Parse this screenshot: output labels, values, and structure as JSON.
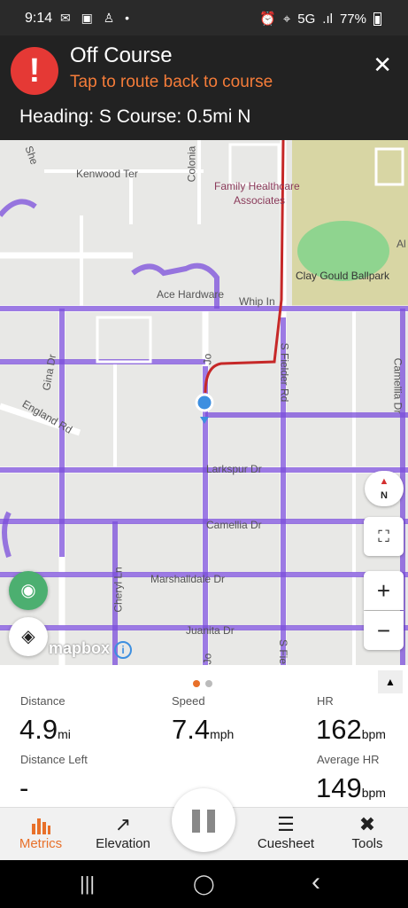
{
  "status_bar": {
    "time": "9:14",
    "left_icons": "✉ ▣ ♙ •",
    "alarm_icon": "⏰",
    "location_icon": "⌖",
    "network": "5G",
    "signal_icon": ".ıl",
    "battery": "77%"
  },
  "banner": {
    "title": "Off Course",
    "subtitle": "Tap to route back to course",
    "heading": "Heading: S Course: 0.5mi N",
    "alert_glyph": "!",
    "close_glyph": "✕",
    "alert_color": "#e53935",
    "subtitle_color": "#f57c39"
  },
  "map": {
    "labels": {
      "kenwood": "Kenwood Ter",
      "colonia": "Colonia",
      "sheri": "She",
      "family": "Family Healthcare",
      "associates": "Associates",
      "clay": "Clay Gould Ballpark",
      "al": "Al",
      "ace": "Ace Hardware",
      "whip": "Whip In",
      "fielder": "S Fielder Rd",
      "fielder2": "S Fie",
      "gina": "Gina Dr",
      "england": "England Rd",
      "camellia_right": "Camellia Dr",
      "larkspur": "Larkspur Dr",
      "camellia": "Camellia Dr",
      "cheryl": "Cheryl Ln",
      "marshalldale": "Marshalldale Dr",
      "juanita": "Juanita Dr",
      "jo": "Jo",
      "jo2": "Jo"
    },
    "attribution": "mapbox",
    "info_glyph": "i",
    "compass_letter": "N",
    "zoom_in": "+",
    "zoom_out": "−",
    "fullscreen_glyph": "⛶",
    "heatmap_color": "#7b4ddb",
    "route_color": "#c62828"
  },
  "metrics": {
    "distance_label": "Distance",
    "distance_value": "4.9",
    "distance_unit": "mi",
    "speed_label": "Speed",
    "speed_value": "7.4",
    "speed_unit": "mph",
    "hr_label": "HR",
    "hr_value": "162",
    "hr_unit": "bpm",
    "distance_left_label": "Distance Left",
    "distance_left_value": "-",
    "avg_hr_label": "Average HR",
    "avg_hr_value": "149",
    "avg_hr_unit": "bpm",
    "collapse_glyph": "▲"
  },
  "nav": {
    "metrics": "Metrics",
    "elevation": "Elevation",
    "cuesheet": "Cuesheet",
    "tools": "Tools",
    "elevation_glyph": "↗",
    "cuesheet_glyph": "☰",
    "tools_glyph": "✖",
    "active_color": "#e8702a"
  },
  "system_nav": {
    "recents": "|||",
    "home": "◯",
    "back": "‹"
  }
}
